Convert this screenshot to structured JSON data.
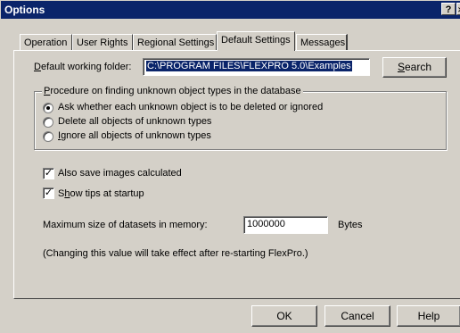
{
  "window": {
    "title": "Options",
    "help_glyph": "?",
    "close_glyph": "✕"
  },
  "tabs": [
    {
      "label": "Operation",
      "active": false
    },
    {
      "label": "User Rights",
      "active": false
    },
    {
      "label": "Regional Settings",
      "active": false
    },
    {
      "label": "Default Settings",
      "active": true
    },
    {
      "label": "Messages",
      "active": false
    }
  ],
  "folder": {
    "label_hot": "D",
    "label_rest": "efault working folder:",
    "value": "C:\\PROGRAM FILES\\FLEXPRO 5.0\\Examples",
    "search_hot": "S",
    "search_rest": "earch"
  },
  "procedure": {
    "legend_hot": "P",
    "legend_rest": "rocedure on finding unknown object types in the database",
    "options": [
      {
        "label": "Ask whether each unknown object is to be deleted or ignored",
        "selected": true
      },
      {
        "label": "Delete all objects of unknown types",
        "selected": false
      },
      {
        "label": "Ignore all objects of unknown types",
        "selected": false
      }
    ],
    "ignore_hot": "I",
    "ignore_rest": "gnore all objects of unknown types"
  },
  "checks": {
    "save_images": {
      "label": "Also save images calculated",
      "checked": true
    },
    "show_tips": {
      "label_pre": "S",
      "label_hot": "h",
      "label_rest": "ow tips at startup",
      "checked": true
    }
  },
  "datasets": {
    "label": "Maximum size of datasets in memory:",
    "value": "1000000",
    "unit": "Bytes",
    "note": "(Changing this value will take effect after re-starting FlexPro.)"
  },
  "buttons": {
    "ok": "OK",
    "cancel": "Cancel",
    "help": "Help"
  }
}
